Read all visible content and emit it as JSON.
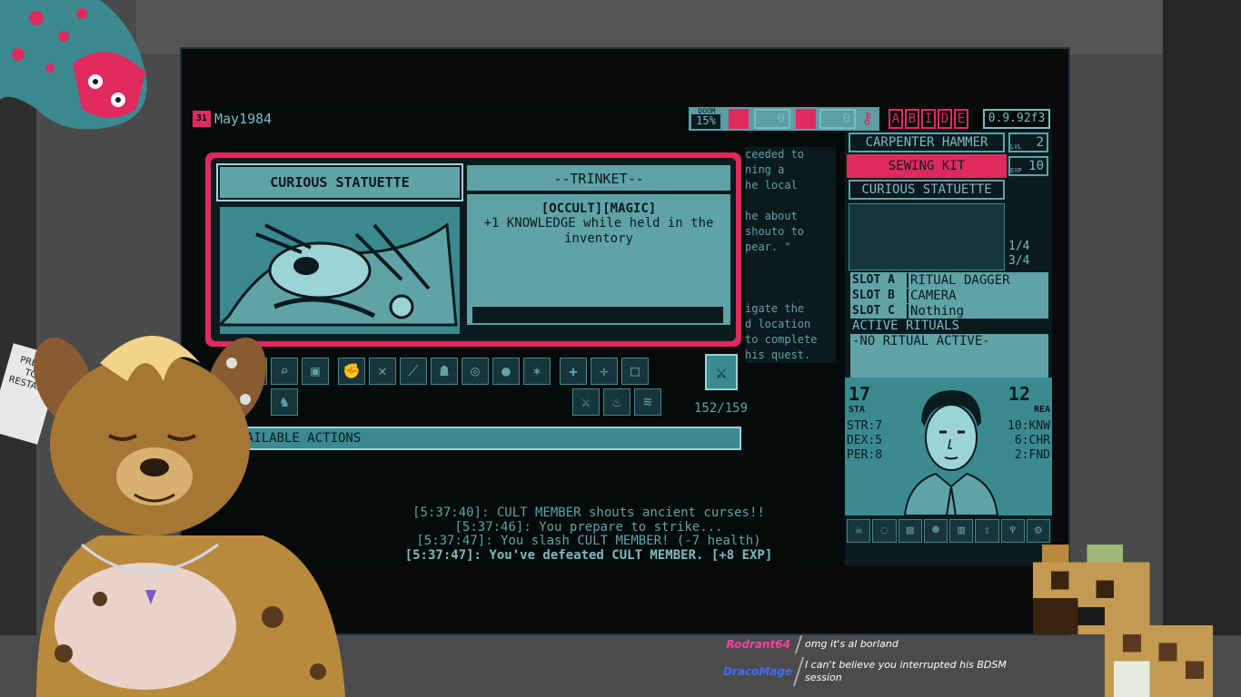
{
  "game": {
    "date": "May1984",
    "date_icon": "31",
    "doom_label": "DOOM",
    "doom_value": "15%",
    "counter_1": "0",
    "counter_2": "0",
    "mystery_letters": [
      "A",
      "B",
      "I",
      "D",
      "E"
    ],
    "version": "0.9.92f3",
    "card": {
      "title": "CURIOUS STATUETTE",
      "type": "--TRINKET--",
      "tags": "[OCCULT][MAGIC]",
      "effect": "+1 KNOWLEDGE while held in the inventory"
    },
    "bg_text": [
      "ceeded to",
      "ning a",
      "he local",
      "",
      "he about",
      "shouto to",
      "pear. \"",
      "",
      "",
      "",
      "igate the",
      "d location",
      "to complete",
      "his quest."
    ],
    "action_points": "152/159",
    "available_actions": "AVAILABLE ACTIONS",
    "log": [
      "[5:37:40]: CULT MEMBER shouts ancient curses!!",
      "[5:37:46]: You prepare to strike...",
      "[5:37:47]: You slash CULT MEMBER! (-7 health)",
      "[5:37:47]: You've defeated CULT MEMBER. [+8 EXP]"
    ],
    "inventory": [
      {
        "label": "CARPENTER HAMMER",
        "state": "normal"
      },
      {
        "label": "SEWING KIT",
        "state": "selected"
      },
      {
        "label": "CURIOUS STATUETTE",
        "state": "normal"
      }
    ],
    "level_label": "LVL",
    "level": "2",
    "exp_label": "EXP",
    "exp": "10",
    "ratio_1": "1/4",
    "ratio_2": "3/4",
    "slots": [
      {
        "key": "SLOT A",
        "value": "RITUAL DAGGER"
      },
      {
        "key": "SLOT B",
        "value": "CAMERA"
      },
      {
        "key": "SLOT C",
        "value": "Nothing"
      }
    ],
    "rituals_header": "ACTIVE RITUALS",
    "rituals_none": "-NO RITUAL ACTIVE-",
    "character": {
      "sta": "17",
      "sta_label": "STA",
      "rea": "12",
      "rea_label": "REA",
      "left_stats": [
        "STR:7",
        "DEX:5",
        "PER:8"
      ],
      "right_stats": [
        "10:KNW",
        "6:CHR",
        "2:FND"
      ]
    }
  },
  "overlay": {
    "note": [
      "PRESS",
      "TO",
      "RESTART"
    ]
  },
  "chat": [
    {
      "user": "Rodrant64",
      "color": "#ff3fa6",
      "message": "omg it's al borland"
    },
    {
      "user": "DracoMage",
      "color": "#3f6bff",
      "message": "I can't believe you interrupted his BDSM session"
    }
  ],
  "colors": {
    "teal": "#3a8a90",
    "light_teal": "#7bbcc0",
    "pink": "#e02a5f",
    "dark": "#0b1a1d"
  }
}
